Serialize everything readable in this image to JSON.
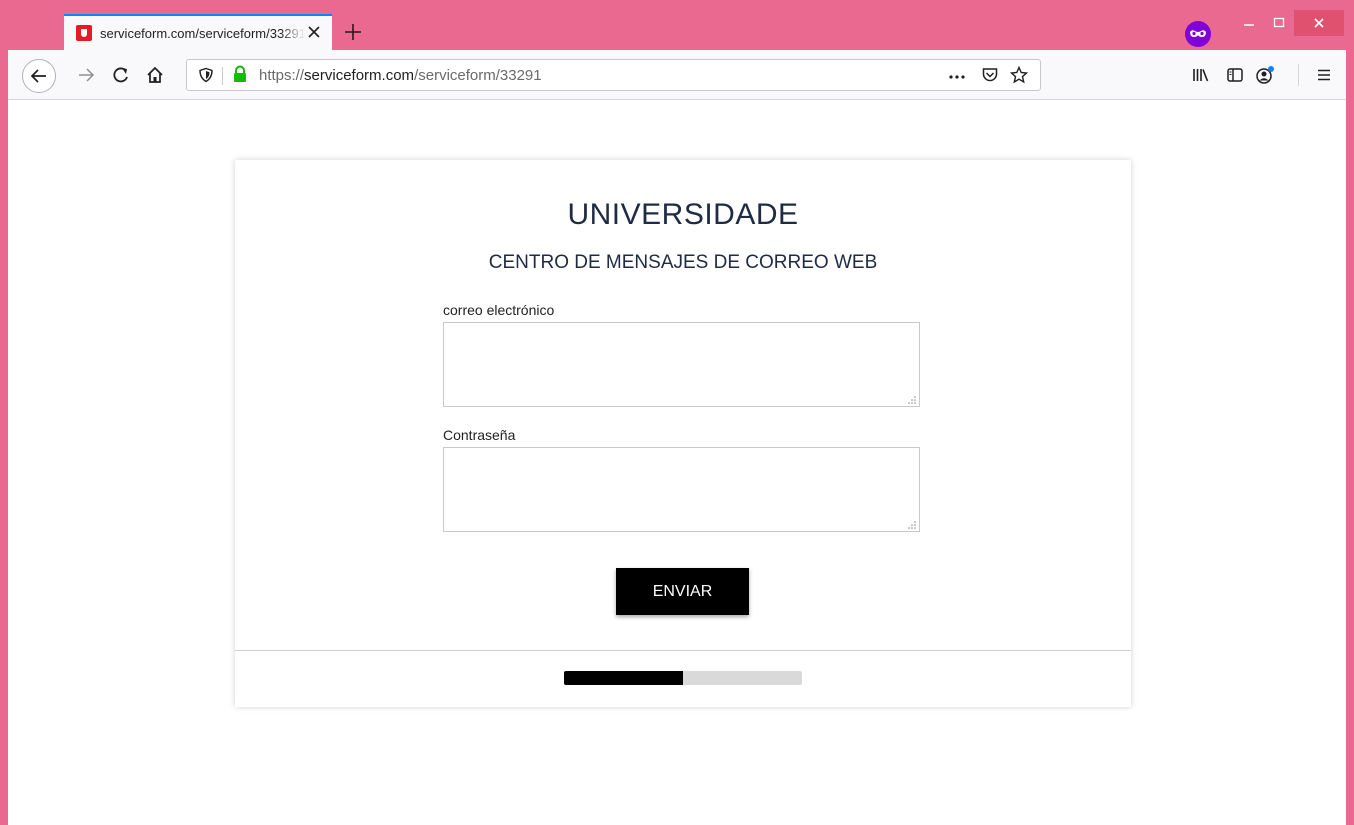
{
  "browser": {
    "tab_title": "serviceform.com/serviceform/33291",
    "url_prefix": "https://",
    "url_domain": "serviceform.com",
    "url_path": "/serviceform/33291",
    "theme_color": "#e96990",
    "accent_color": "#0a84ff",
    "favicon_color": "#e31b23",
    "private_icon_color": "#8000d7",
    "lock_color": "#12bc00"
  },
  "page": {
    "title": "UNIVERSIDADE",
    "subtitle": "CENTRO DE MENSAJES DE CORREO WEB",
    "email_label": "correo electrónico",
    "email_value": "",
    "password_label": "Contraseña",
    "password_value": "",
    "submit_label": "ENVIAR",
    "progress": 0.5
  }
}
